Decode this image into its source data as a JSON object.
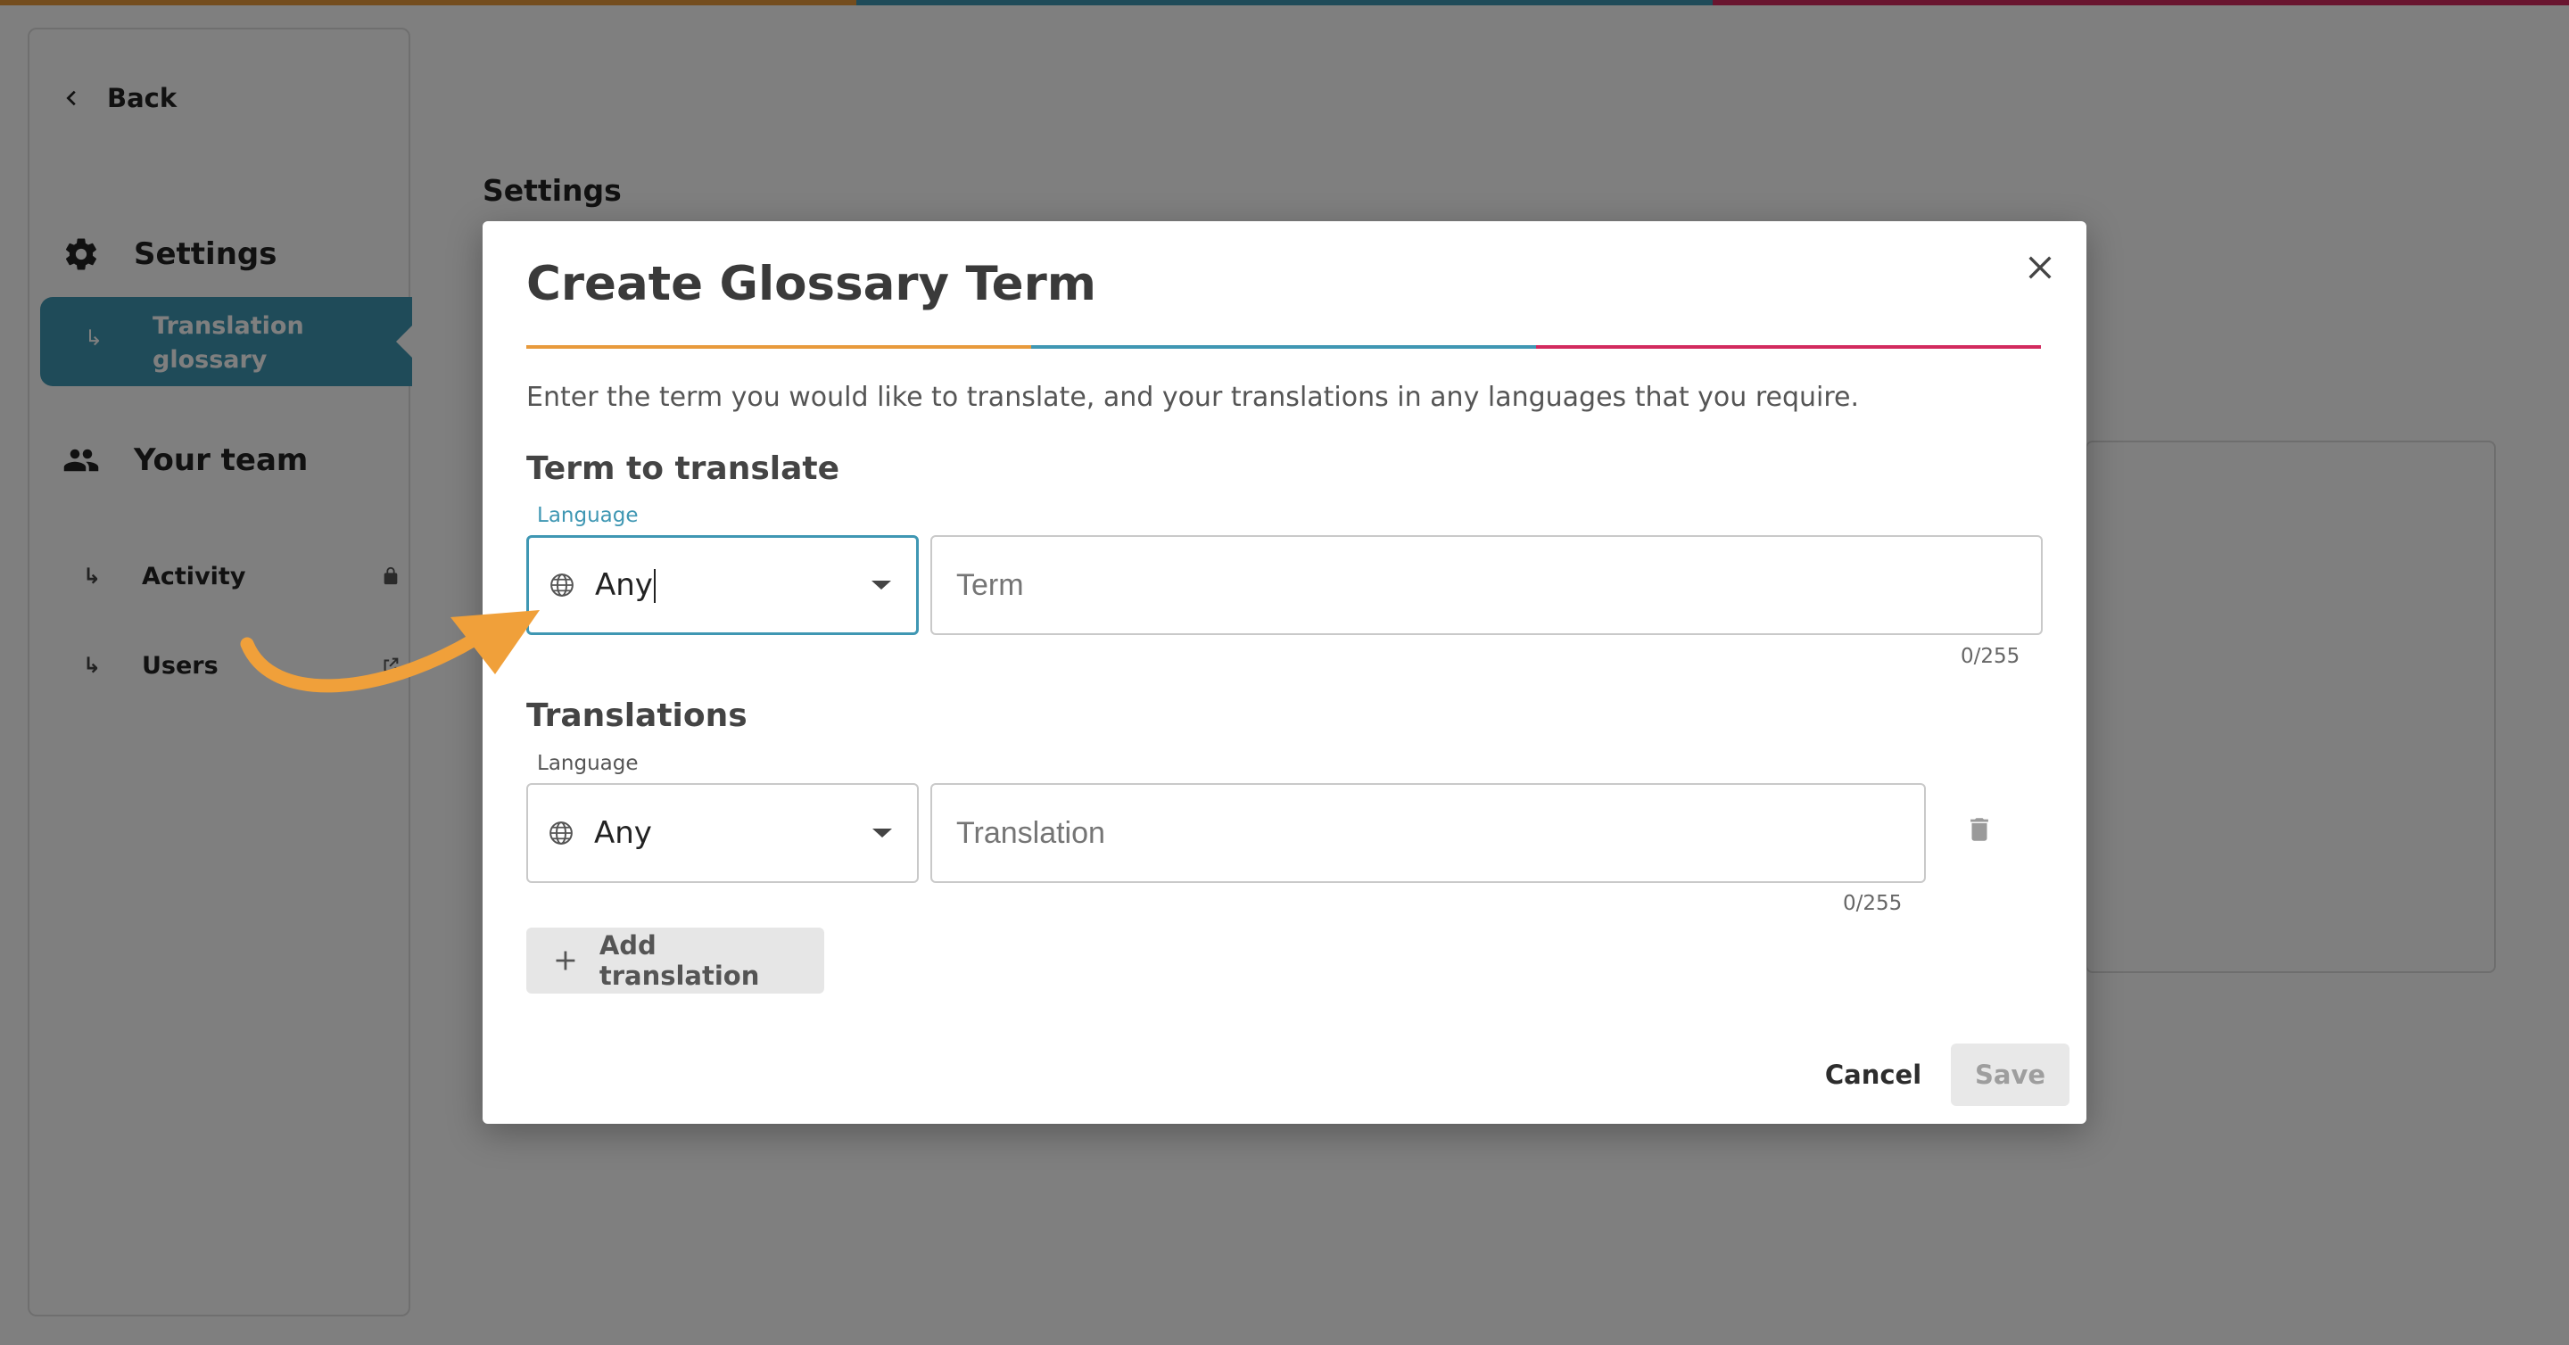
{
  "colors": {
    "accent_orange": "#e89a3c",
    "accent_teal": "#3f97b3",
    "accent_pink": "#d22a5e",
    "sidebar_active": "#3f97b3",
    "annotation_arrow": "#f0a03a"
  },
  "sidebar": {
    "back_label": "Back",
    "back_icon": "chevron-left-icon",
    "settings_heading": "Settings",
    "settings_icon": "gear-icon",
    "active_item": {
      "hook": "↳",
      "label": "Translation glossary"
    },
    "team_heading": "Your team",
    "team_icon": "people-icon",
    "items": [
      {
        "hook": "↳",
        "label": "Activity",
        "icon": "lock-icon"
      },
      {
        "hook": "↳",
        "label": "Users",
        "icon": "external-link-icon"
      }
    ]
  },
  "page": {
    "title": "Settings"
  },
  "modal": {
    "title": "Create Glossary Term",
    "close_icon": "close-icon",
    "description": "Enter the term you would like to translate, and your translations in any languages that you require.",
    "term_section": {
      "heading": "Term to translate",
      "language_label": "Language",
      "language_value": "Any",
      "term_placeholder": "Term",
      "term_counter": "0/255"
    },
    "translations_section": {
      "heading": "Translations",
      "language_label": "Language",
      "language_value": "Any",
      "translation_placeholder": "Translation",
      "translation_counter": "0/255",
      "delete_icon": "trash-icon"
    },
    "add_translation_label": "Add translation",
    "add_icon": "plus-icon",
    "cancel_label": "Cancel",
    "save_label": "Save"
  }
}
